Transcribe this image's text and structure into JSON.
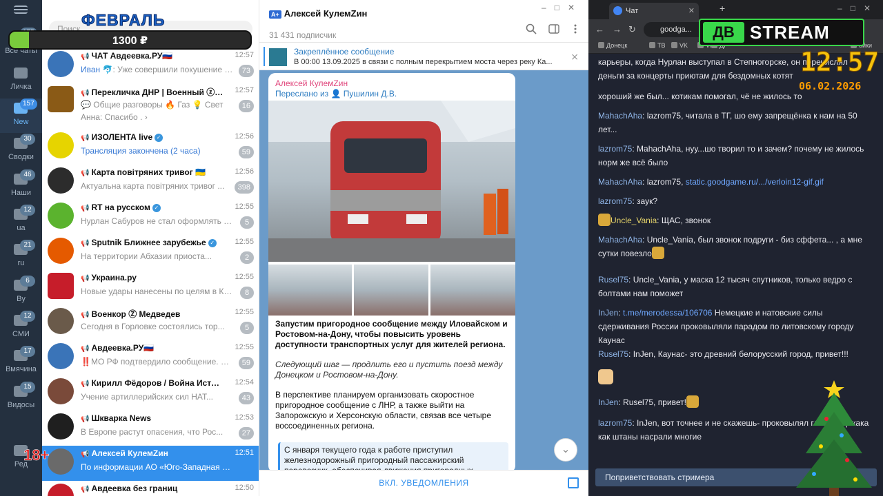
{
  "overlay": {
    "month": "ФЕВРАЛЬ",
    "amount": "1300 ₽",
    "progress_fraction": 0.08,
    "age_badge": "18+"
  },
  "telegram": {
    "folders": [
      {
        "label": "Все чаты",
        "badge": "175",
        "active": false
      },
      {
        "label": "Личка",
        "badge": "",
        "active": false
      },
      {
        "label": "New",
        "badge": "157",
        "active": true
      },
      {
        "label": "Сводки",
        "badge": "30",
        "active": false
      },
      {
        "label": "Наши",
        "badge": "46",
        "active": false
      },
      {
        "label": "ua",
        "badge": "12",
        "active": false
      },
      {
        "label": "ru",
        "badge": "21",
        "active": false
      },
      {
        "label": "By",
        "badge": "6",
        "active": false
      },
      {
        "label": "СМИ",
        "badge": "12",
        "active": false
      },
      {
        "label": "Вмячина",
        "badge": "17",
        "active": false
      },
      {
        "label": "Видосы",
        "badge": "15",
        "active": false
      },
      {
        "label": "Ред",
        "badge": "",
        "active": false
      }
    ],
    "search_placeholder": "Поиск",
    "chats": [
      {
        "title": "ЧАТ Авдеевка.РУ🇷🇺",
        "time": "12:57",
        "sender": "Иван",
        "preview": "🐬: Уже совершили покушение на ...",
        "badge": "73",
        "color": "#3a74b8"
      },
      {
        "title": "Перекличка ДНР | Военный ⓩ Дон...",
        "time": "12:57",
        "sender": "",
        "preview": "💬 Общие разговоры 🔥 Газ 💡 Свет",
        "preview2": "Анна: Спасибо . ›",
        "badge": "16",
        "color": "#8a5a16"
      },
      {
        "title": "ИЗОЛЕНТА live",
        "time": "12:56",
        "sender": "",
        "preview": "Трансляция закончена (2 часа)",
        "badge": "59",
        "color": "#e6d400",
        "blue": true
      },
      {
        "title": "Карта повітряних тривог 🇺🇦",
        "time": "12:56",
        "sender": "",
        "preview": "Актуальна карта повітряних тривог ...",
        "badge": "398",
        "color": "#2c2c2c"
      },
      {
        "title": "RT на русском",
        "time": "12:55",
        "sender": "",
        "preview": "Нурлан Сабуров не стал оформлять ро...",
        "badge": "5",
        "color": "#5bb32e"
      },
      {
        "title": "Sputnik Ближнее зарубежье",
        "time": "12:55",
        "sender": "",
        "preview": "На территории Абхазии приоста...",
        "badge": "2",
        "color": "#e55a00"
      },
      {
        "title": "Украина.ру",
        "time": "12:55",
        "sender": "",
        "preview": "Новые удары нанесены по целям в Ки...",
        "badge": "8",
        "color": "#c61d2a"
      },
      {
        "title": "Военкор Ⓩ Медведев",
        "time": "12:55",
        "sender": "",
        "preview": "Сегодня в Горловке состоялись тор...",
        "badge": "5",
        "color": "#6a5a4a"
      },
      {
        "title": "Авдеевка.РУ🇷🇺",
        "time": "12:55",
        "sender": "",
        "preview": "‼️МО РФ подтвердило сообщение. Под...",
        "badge": "59",
        "color": "#3a74b8"
      },
      {
        "title": "Кирилл Фёдоров / Война История О...",
        "time": "12:54",
        "sender": "",
        "preview": "Учение артиллерийских сил НАТ...",
        "badge": "43",
        "color": "#7a4a3a"
      },
      {
        "title": "Шкварка News",
        "time": "12:53",
        "sender": "",
        "preview": "В Европе растут опасения, что Рос...",
        "badge": "27",
        "color": "#1f1f1f"
      },
      {
        "title": "Алексей КулемZин",
        "time": "12:51",
        "sender": "",
        "preview": "По информации АО «Юго-Западная Эле...",
        "badge": "",
        "color": "#6a6a6a",
        "selected": true
      },
      {
        "title": "Авдеевка без границ",
        "time": "12:50",
        "sender": "",
        "preview": "",
        "badge": "",
        "color": "#c61d2a"
      }
    ],
    "channel": {
      "name": "Алексей КулемZин",
      "name_prefix": "А+",
      "subscribers": "31 431 подписчик",
      "pinned_title": "Закреплённое сообщение",
      "pinned_text": "В 00:00 13.09.2025 в связи с полным перекрытием моста через реку Ка..."
    },
    "post": {
      "author": "Алексей КулемZин",
      "forwarded": "Переслано из 👤 Пушилин Д.В.",
      "bold_text": "Запустим пригородное сообщение между Иловайском и Ростовом-на-Дону, чтобы повысить уровень доступности транспортных услуг для жителей региона.",
      "italic_text": "Следующий шаг — продлить его и пустить поезд между Донецком и Ростовом-на-Дону.",
      "body_text": "В перспективе планируем организовать скоростное пригородное сообщение с ЛНР, а также выйти на Запорожскую и Херсонскую области, связав все четыре воссоединенных региона.",
      "quote_text": "С января текущего года к работе приступил железнодорожный пригородный пассажирский перевозчик, обеспечивая движения пригородных поездов ..."
    },
    "mute_label": "ВКЛ. УВЕДОМЛЕНИЯ"
  },
  "browser": {
    "tab_title": "Чат",
    "url": "goodga...",
    "bookmarks": [
      "Донецк",
      "ТВ",
      "VK",
      "VK",
      "ДІ",
      "ойки"
    ],
    "logo_left": "ДВ",
    "logo_right": "STREAM",
    "clock_time": "12:57",
    "clock_date": "06.02.2026",
    "messages": [
      {
        "user": "",
        "text": "карьеры, когда Нурлан выступал в Степногорске, он перечислял деньги за концерты приютам для бездомных котят"
      },
      {
        "user": "",
        "text": "хороший же был... котикам помогал, чё не жилось то"
      },
      {
        "user": "MahachAha",
        "text": "lazrom75, читала в ТГ, шо ему запрещёнка к нам на 50 лет..."
      },
      {
        "user": "lazrom75",
        "text": "MahachAha, нуу...шо творил то и зачем? почему не жилось норм же всё было"
      },
      {
        "user": "MahachAha",
        "text": "lazrom75, static.goodgame.ru/.../verloin12-gif.gif",
        "link": "static.goodgame.ru/.../verloin12-gif.gif"
      },
      {
        "user": "lazrom75",
        "text": "заук?"
      },
      {
        "user": "Uncle_Vania",
        "text": "ЩАС, звонок"
      },
      {
        "user": "MahachAha",
        "text": "Uncle_Vania, был звонок подруги - биз сффета... , а мне сутки повезло"
      },
      {
        "user": "Rusel75",
        "text": "Uncle_Vania, у маска 12 тысяч спутников, только ведро с болтами нам поможет"
      },
      {
        "user": "InJen",
        "text": "t.me/merodessa/106706 Немецкие и натовские силы сдерживания России проковыляли парадом по литовскому городу Каунас",
        "link": "t.me/merodessa/106706"
      },
      {
        "user": "Rusel75",
        "text": "InJen, Каунас- это древний белорусский город, привет!!!"
      },
      {
        "user": "InJen",
        "text": "Rusel75, привет!"
      },
      {
        "user": "lazrom75",
        "text": "InJen, вот точнее и не скажешь- проковылял глянула, ржака как штаны насрали многие"
      }
    ],
    "greet_button": "Поприветствовать стримера"
  }
}
